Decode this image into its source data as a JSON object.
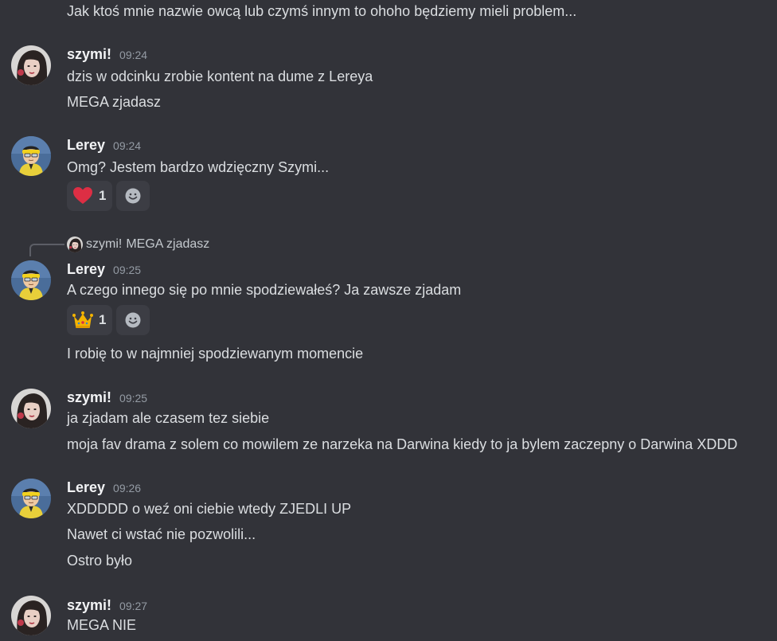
{
  "colors": {
    "background": "#323339",
    "text": "#dbdee1",
    "username": "#f2f3f5",
    "timestamp": "#949ba4",
    "reaction_bg": "#3c3d44"
  },
  "top_message": "Jak ktoś mnie nazwie owcą lub czymś innym to ohoho będziemy mieli problem...",
  "groups": [
    {
      "username": "szymi!",
      "time": "09:24",
      "lines": [
        "dzis w odcinku zrobie kontent na dume z Lereya",
        "MEGA zjadasz"
      ]
    },
    {
      "username": "Lerey",
      "time": "09:24",
      "lines": [
        "Omg? Jestem bardzo wdzięczny Szymi..."
      ],
      "reaction": {
        "emoji": "heart-icon",
        "count": "1"
      }
    },
    {
      "reply": {
        "username": "szymi!",
        "text": "MEGA zjadasz"
      },
      "username": "Lerey",
      "time": "09:25",
      "lines": [
        "A czego innego się po mnie spodziewałeś? Ja zawsze zjadam",
        "I robię to w najmniej spodziewanym momencie"
      ],
      "reaction": {
        "emoji": "crown-icon",
        "count": "1"
      }
    },
    {
      "username": "szymi!",
      "time": "09:25",
      "lines": [
        "ja zjadam ale czasem tez siebie",
        "moja fav drama z solem co mowilem ze narzeka na Darwina kiedy to ja bylem zaczepny o Darwina XDDD"
      ]
    },
    {
      "username": "Lerey",
      "time": "09:26",
      "lines": [
        "XDDDDD o weź oni ciebie wtedy ZJEDLI UP",
        "Nawet ci wstać nie pozwolili...",
        "Ostro było"
      ]
    },
    {
      "username": "szymi!",
      "time": "09:27",
      "lines": [
        "MEGA NIE"
      ]
    }
  ]
}
